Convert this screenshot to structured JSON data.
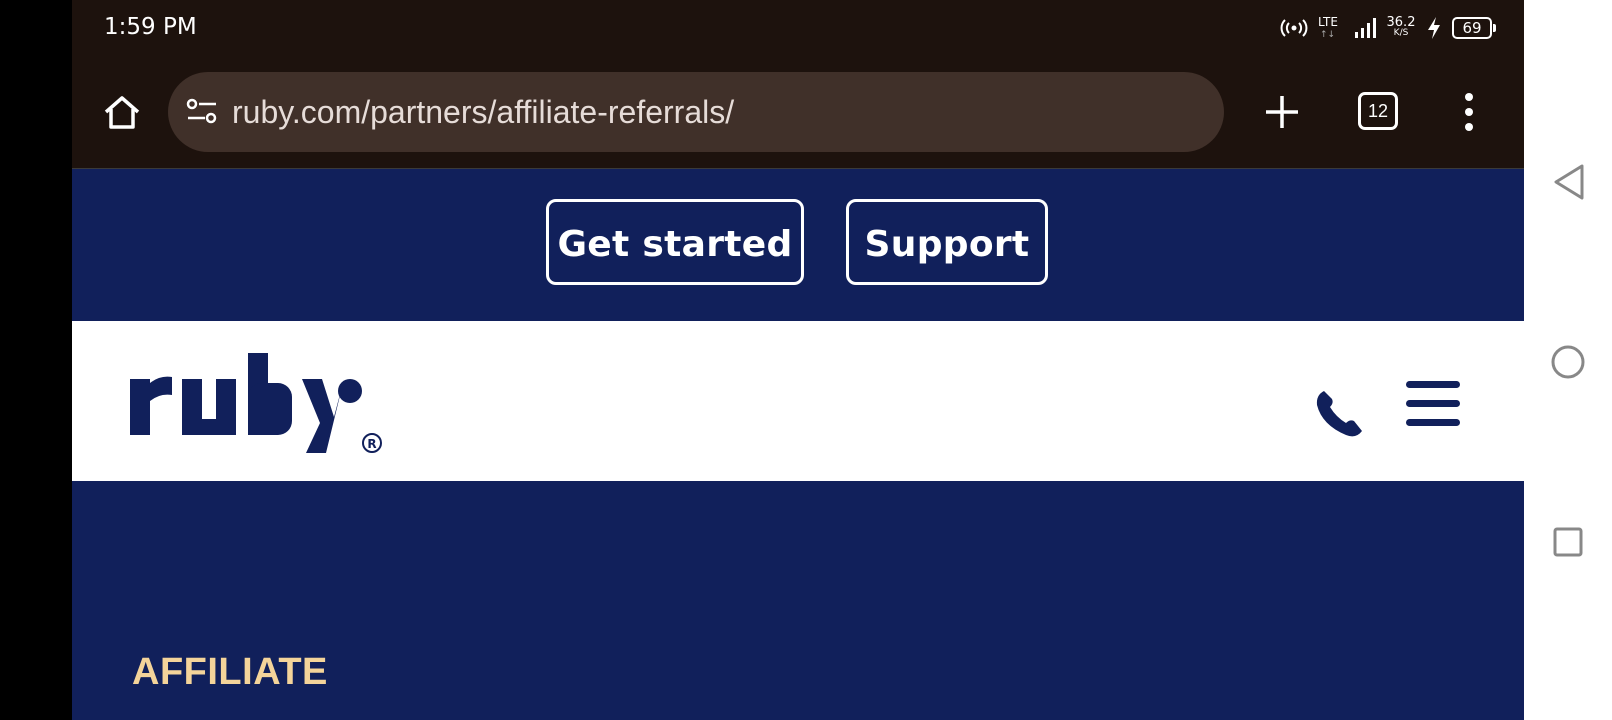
{
  "status_bar": {
    "time": "1:59 PM",
    "network_type": "LTE",
    "net_speed_value": "36.2",
    "net_speed_unit": "K/S",
    "battery": "69"
  },
  "browser": {
    "url": "ruby.com/partners/affiliate-referrals/",
    "tab_count": "12"
  },
  "promo": {
    "get_started_label": "Get started",
    "support_label": "Support"
  },
  "hero": {
    "eyebrow": "AFFILIATE"
  },
  "colors": {
    "brand_navy": "#11205b",
    "accent_gold": "#f4d49a",
    "browser_dark": "#1d120d"
  },
  "icons": [
    "home-icon",
    "site-info-icon",
    "plus-icon",
    "tabs-icon",
    "more-vert-icon",
    "phone-icon",
    "hamburger-icon",
    "back-icon",
    "home-circle-icon",
    "recents-icon"
  ]
}
